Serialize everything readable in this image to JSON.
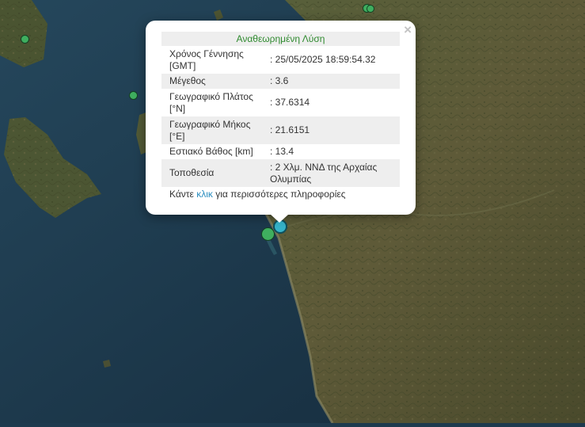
{
  "map": {
    "colors": {
      "sea": "#1d3a4e",
      "land": "#4e5a32",
      "selected_marker": "#35b3c9",
      "marker": "#3fae5f"
    },
    "markers": [
      {
        "name": "earthquake-marker"
      },
      {
        "name": "earthquake-marker"
      },
      {
        "name": "earthquake-marker"
      },
      {
        "name": "earthquake-marker"
      },
      {
        "name": "earthquake-marker"
      },
      {
        "name": "earthquake-marker-selected"
      }
    ]
  },
  "popup": {
    "close_label": "×",
    "title": "Αναθεωρημένη Λύση",
    "rows": [
      {
        "label": "Χρόνος Γέννησης [GMT]",
        "value": ": 25/05/2025 18:59:54.32"
      },
      {
        "label": "Μέγεθος",
        "value": ": 3.6"
      },
      {
        "label": "Γεωγραφικό Πλάτος [°N]",
        "value": ": 37.6314"
      },
      {
        "label": "Γεωγραφικό Μήκος [°E]",
        "value": ": 21.6151"
      },
      {
        "label": "Εστιακό Βάθος [km]",
        "value": ": 13.4"
      },
      {
        "label": "Τοποθεσία",
        "value": ": 2 Χλμ. ΝΝΔ της Αρχαίας Ολυμπίας"
      }
    ],
    "footer": {
      "prefix": "Κάντε ",
      "link": "κλικ",
      "suffix": " για περισσότερες πληροφορίες"
    }
  }
}
